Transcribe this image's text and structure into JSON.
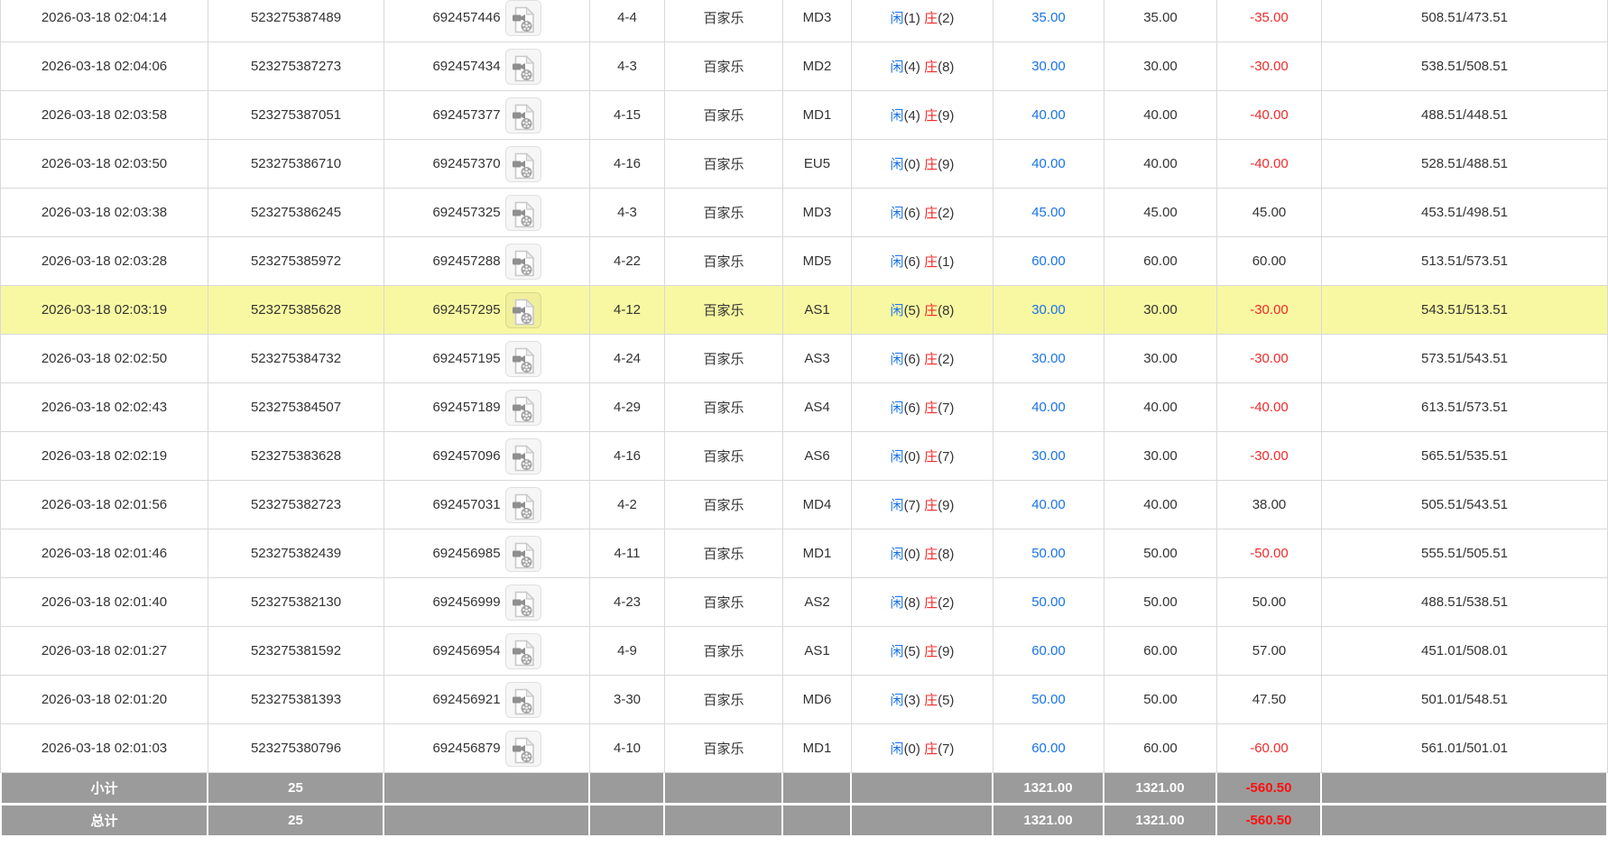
{
  "table": {
    "columns": [
      "bet-time",
      "bet-id",
      "round-no",
      "shoe-round",
      "game-name",
      "table-code",
      "game-result",
      "bet-amount",
      "valid-amount",
      "win-loss",
      "balance"
    ],
    "result_labels": {
      "player": "闲",
      "banker": "庄"
    },
    "icons": {
      "video_replay": "video-replay-icon"
    },
    "rows": [
      {
        "time": "2026-03-18 02:04:14",
        "bet_id": "523275387489",
        "round_no": "692457446",
        "shoe": "4-4",
        "game": "百家乐",
        "table": "MD3",
        "player": "1",
        "banker": "2",
        "bet": "35.00",
        "valid": "35.00",
        "win_loss": "-35.00",
        "balance": "508.51/473.51",
        "highlighted": false
      },
      {
        "time": "2026-03-18 02:04:06",
        "bet_id": "523275387273",
        "round_no": "692457434",
        "shoe": "4-3",
        "game": "百家乐",
        "table": "MD2",
        "player": "4",
        "banker": "8",
        "bet": "30.00",
        "valid": "30.00",
        "win_loss": "-30.00",
        "balance": "538.51/508.51",
        "highlighted": false
      },
      {
        "time": "2026-03-18 02:03:58",
        "bet_id": "523275387051",
        "round_no": "692457377",
        "shoe": "4-15",
        "game": "百家乐",
        "table": "MD1",
        "player": "4",
        "banker": "9",
        "bet": "40.00",
        "valid": "40.00",
        "win_loss": "-40.00",
        "balance": "488.51/448.51",
        "highlighted": false
      },
      {
        "time": "2026-03-18 02:03:50",
        "bet_id": "523275386710",
        "round_no": "692457370",
        "shoe": "4-16",
        "game": "百家乐",
        "table": "EU5",
        "player": "0",
        "banker": "9",
        "bet": "40.00",
        "valid": "40.00",
        "win_loss": "-40.00",
        "balance": "528.51/488.51",
        "highlighted": false
      },
      {
        "time": "2026-03-18 02:03:38",
        "bet_id": "523275386245",
        "round_no": "692457325",
        "shoe": "4-3",
        "game": "百家乐",
        "table": "MD3",
        "player": "6",
        "banker": "2",
        "bet": "45.00",
        "valid": "45.00",
        "win_loss": "45.00",
        "balance": "453.51/498.51",
        "highlighted": false
      },
      {
        "time": "2026-03-18 02:03:28",
        "bet_id": "523275385972",
        "round_no": "692457288",
        "shoe": "4-22",
        "game": "百家乐",
        "table": "MD5",
        "player": "6",
        "banker": "1",
        "bet": "60.00",
        "valid": "60.00",
        "win_loss": "60.00",
        "balance": "513.51/573.51",
        "highlighted": false
      },
      {
        "time": "2026-03-18 02:03:19",
        "bet_id": "523275385628",
        "round_no": "692457295",
        "shoe": "4-12",
        "game": "百家乐",
        "table": "AS1",
        "player": "5",
        "banker": "8",
        "bet": "30.00",
        "valid": "30.00",
        "win_loss": "-30.00",
        "balance": "543.51/513.51",
        "highlighted": true
      },
      {
        "time": "2026-03-18 02:02:50",
        "bet_id": "523275384732",
        "round_no": "692457195",
        "shoe": "4-24",
        "game": "百家乐",
        "table": "AS3",
        "player": "6",
        "banker": "2",
        "bet": "30.00",
        "valid": "30.00",
        "win_loss": "-30.00",
        "balance": "573.51/543.51",
        "highlighted": false
      },
      {
        "time": "2026-03-18 02:02:43",
        "bet_id": "523275384507",
        "round_no": "692457189",
        "shoe": "4-29",
        "game": "百家乐",
        "table": "AS4",
        "player": "6",
        "banker": "7",
        "bet": "40.00",
        "valid": "40.00",
        "win_loss": "-40.00",
        "balance": "613.51/573.51",
        "highlighted": false
      },
      {
        "time": "2026-03-18 02:02:19",
        "bet_id": "523275383628",
        "round_no": "692457096",
        "shoe": "4-16",
        "game": "百家乐",
        "table": "AS6",
        "player": "0",
        "banker": "7",
        "bet": "30.00",
        "valid": "30.00",
        "win_loss": "-30.00",
        "balance": "565.51/535.51",
        "highlighted": false
      },
      {
        "time": "2026-03-18 02:01:56",
        "bet_id": "523275382723",
        "round_no": "692457031",
        "shoe": "4-2",
        "game": "百家乐",
        "table": "MD4",
        "player": "7",
        "banker": "9",
        "bet": "40.00",
        "valid": "40.00",
        "win_loss": "38.00",
        "balance": "505.51/543.51",
        "highlighted": false
      },
      {
        "time": "2026-03-18 02:01:46",
        "bet_id": "523275382439",
        "round_no": "692456985",
        "shoe": "4-11",
        "game": "百家乐",
        "table": "MD1",
        "player": "0",
        "banker": "8",
        "bet": "50.00",
        "valid": "50.00",
        "win_loss": "-50.00",
        "balance": "555.51/505.51",
        "highlighted": false
      },
      {
        "time": "2026-03-18 02:01:40",
        "bet_id": "523275382130",
        "round_no": "692456999",
        "shoe": "4-23",
        "game": "百家乐",
        "table": "AS2",
        "player": "8",
        "banker": "2",
        "bet": "50.00",
        "valid": "50.00",
        "win_loss": "50.00",
        "balance": "488.51/538.51",
        "highlighted": false
      },
      {
        "time": "2026-03-18 02:01:27",
        "bet_id": "523275381592",
        "round_no": "692456954",
        "shoe": "4-9",
        "game": "百家乐",
        "table": "AS1",
        "player": "5",
        "banker": "9",
        "bet": "60.00",
        "valid": "60.00",
        "win_loss": "57.00",
        "balance": "451.01/508.01",
        "highlighted": false
      },
      {
        "time": "2026-03-18 02:01:20",
        "bet_id": "523275381393",
        "round_no": "692456921",
        "shoe": "3-30",
        "game": "百家乐",
        "table": "MD6",
        "player": "3",
        "banker": "5",
        "bet": "50.00",
        "valid": "50.00",
        "win_loss": "47.50",
        "balance": "501.01/548.51",
        "highlighted": false
      },
      {
        "time": "2026-03-18 02:01:03",
        "bet_id": "523275380796",
        "round_no": "692456879",
        "shoe": "4-10",
        "game": "百家乐",
        "table": "MD1",
        "player": "0",
        "banker": "7",
        "bet": "60.00",
        "valid": "60.00",
        "win_loss": "-60.00",
        "balance": "561.01/501.01",
        "highlighted": false
      }
    ],
    "summary": [
      {
        "label": "小计",
        "count": "25",
        "bet": "1321.00",
        "valid": "1321.00",
        "win_loss": "-560.50"
      },
      {
        "label": "总计",
        "count": "25",
        "bet": "1321.00",
        "valid": "1321.00",
        "win_loss": "-560.50"
      }
    ]
  },
  "colors": {
    "accent_blue": "#1a73e8",
    "loss_red": "#ef2b2b",
    "summary_loss_red": "#ff0f0f",
    "highlight_yellow": "#f8f8a2",
    "summary_gray": "#9b9b9b",
    "border_gray": "#d9d9d9"
  }
}
